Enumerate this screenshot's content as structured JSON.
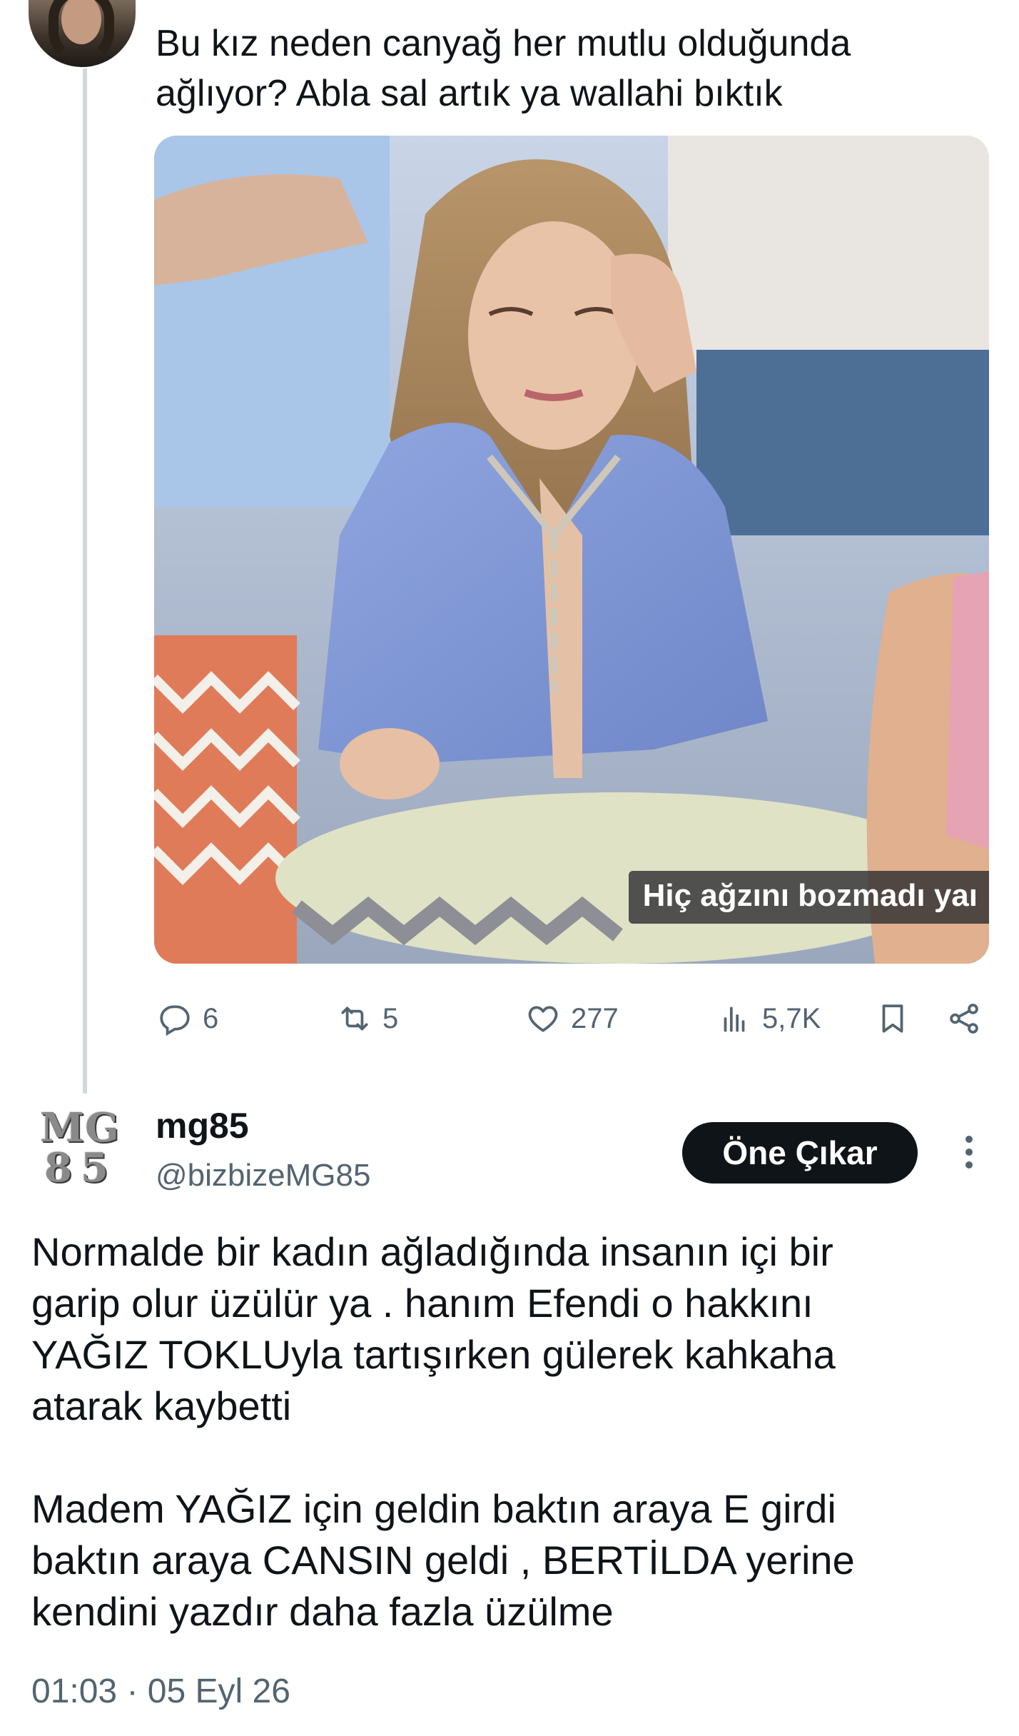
{
  "parent_tweet": {
    "text_lines": [
      "Bu kız neden canyağ her mutlu olduğunda",
      "ağlıyor? Abla sal artık ya wallahi bıktık"
    ],
    "media": {
      "subtitle": "Hiç ağzını bozmadı yaı"
    },
    "actions": {
      "replies": "6",
      "reposts": "5",
      "likes": "277",
      "views": "5,7K"
    }
  },
  "main_tweet": {
    "display_name": "mg85",
    "handle": "@bizbizeMG85",
    "logo_line1": "MG",
    "logo_line2": "85",
    "highlight_button": "Öne Çıkar",
    "paragraph1_lines": [
      "Normalde bir kadın ağladığında insanın içi bir",
      "garip olur üzülür ya . hanım Efendi o hakkını",
      "YAĞIZ TOKLUyla tartışırken gülerek kahkaha",
      "atarak kaybetti"
    ],
    "paragraph2_lines": [
      "Madem YAĞIZ için geldin baktın araya E girdi",
      "baktın araya CANSIN geldi , BERTİLDA yerine",
      "kendini yazdır daha fazla üzülme"
    ],
    "timestamp": "01:03 · 05 Eyl 26"
  },
  "colors": {
    "text_primary": "#0f1419",
    "text_secondary": "#536471",
    "thread_line": "#cfd9de",
    "button_bg": "#0f1419"
  },
  "icons": [
    "reply-icon",
    "repost-icon",
    "like-icon",
    "views-icon",
    "bookmark-icon",
    "share-icon",
    "more-icon"
  ]
}
